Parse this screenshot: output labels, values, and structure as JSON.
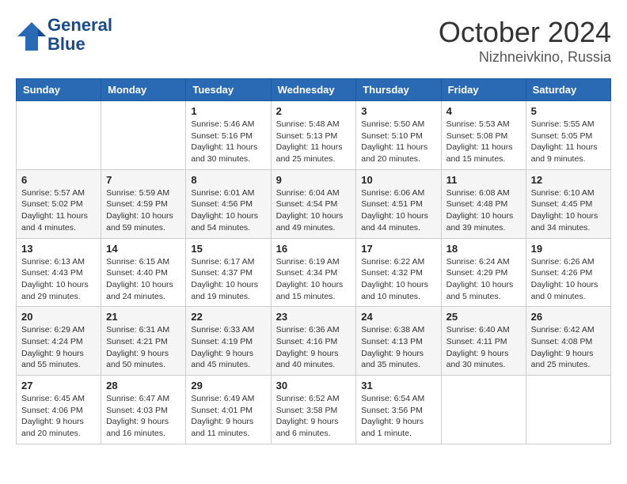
{
  "header": {
    "logo_line1": "General",
    "logo_line2": "Blue",
    "title": "October 2024",
    "subtitle": "Nizhneivkino, Russia"
  },
  "weekdays": [
    "Sunday",
    "Monday",
    "Tuesday",
    "Wednesday",
    "Thursday",
    "Friday",
    "Saturday"
  ],
  "weeks": [
    [
      {
        "day": "",
        "info": ""
      },
      {
        "day": "",
        "info": ""
      },
      {
        "day": "1",
        "info": "Sunrise: 5:46 AM\nSunset: 5:16 PM\nDaylight: 11 hours and 30 minutes."
      },
      {
        "day": "2",
        "info": "Sunrise: 5:48 AM\nSunset: 5:13 PM\nDaylight: 11 hours and 25 minutes."
      },
      {
        "day": "3",
        "info": "Sunrise: 5:50 AM\nSunset: 5:10 PM\nDaylight: 11 hours and 20 minutes."
      },
      {
        "day": "4",
        "info": "Sunrise: 5:53 AM\nSunset: 5:08 PM\nDaylight: 11 hours and 15 minutes."
      },
      {
        "day": "5",
        "info": "Sunrise: 5:55 AM\nSunset: 5:05 PM\nDaylight: 11 hours and 9 minutes."
      }
    ],
    [
      {
        "day": "6",
        "info": "Sunrise: 5:57 AM\nSunset: 5:02 PM\nDaylight: 11 hours and 4 minutes."
      },
      {
        "day": "7",
        "info": "Sunrise: 5:59 AM\nSunset: 4:59 PM\nDaylight: 10 hours and 59 minutes."
      },
      {
        "day": "8",
        "info": "Sunrise: 6:01 AM\nSunset: 4:56 PM\nDaylight: 10 hours and 54 minutes."
      },
      {
        "day": "9",
        "info": "Sunrise: 6:04 AM\nSunset: 4:54 PM\nDaylight: 10 hours and 49 minutes."
      },
      {
        "day": "10",
        "info": "Sunrise: 6:06 AM\nSunset: 4:51 PM\nDaylight: 10 hours and 44 minutes."
      },
      {
        "day": "11",
        "info": "Sunrise: 6:08 AM\nSunset: 4:48 PM\nDaylight: 10 hours and 39 minutes."
      },
      {
        "day": "12",
        "info": "Sunrise: 6:10 AM\nSunset: 4:45 PM\nDaylight: 10 hours and 34 minutes."
      }
    ],
    [
      {
        "day": "13",
        "info": "Sunrise: 6:13 AM\nSunset: 4:43 PM\nDaylight: 10 hours and 29 minutes."
      },
      {
        "day": "14",
        "info": "Sunrise: 6:15 AM\nSunset: 4:40 PM\nDaylight: 10 hours and 24 minutes."
      },
      {
        "day": "15",
        "info": "Sunrise: 6:17 AM\nSunset: 4:37 PM\nDaylight: 10 hours and 19 minutes."
      },
      {
        "day": "16",
        "info": "Sunrise: 6:19 AM\nSunset: 4:34 PM\nDaylight: 10 hours and 15 minutes."
      },
      {
        "day": "17",
        "info": "Sunrise: 6:22 AM\nSunset: 4:32 PM\nDaylight: 10 hours and 10 minutes."
      },
      {
        "day": "18",
        "info": "Sunrise: 6:24 AM\nSunset: 4:29 PM\nDaylight: 10 hours and 5 minutes."
      },
      {
        "day": "19",
        "info": "Sunrise: 6:26 AM\nSunset: 4:26 PM\nDaylight: 10 hours and 0 minutes."
      }
    ],
    [
      {
        "day": "20",
        "info": "Sunrise: 6:29 AM\nSunset: 4:24 PM\nDaylight: 9 hours and 55 minutes."
      },
      {
        "day": "21",
        "info": "Sunrise: 6:31 AM\nSunset: 4:21 PM\nDaylight: 9 hours and 50 minutes."
      },
      {
        "day": "22",
        "info": "Sunrise: 6:33 AM\nSunset: 4:19 PM\nDaylight: 9 hours and 45 minutes."
      },
      {
        "day": "23",
        "info": "Sunrise: 6:36 AM\nSunset: 4:16 PM\nDaylight: 9 hours and 40 minutes."
      },
      {
        "day": "24",
        "info": "Sunrise: 6:38 AM\nSunset: 4:13 PM\nDaylight: 9 hours and 35 minutes."
      },
      {
        "day": "25",
        "info": "Sunrise: 6:40 AM\nSunset: 4:11 PM\nDaylight: 9 hours and 30 minutes."
      },
      {
        "day": "26",
        "info": "Sunrise: 6:42 AM\nSunset: 4:08 PM\nDaylight: 9 hours and 25 minutes."
      }
    ],
    [
      {
        "day": "27",
        "info": "Sunrise: 6:45 AM\nSunset: 4:06 PM\nDaylight: 9 hours and 20 minutes."
      },
      {
        "day": "28",
        "info": "Sunrise: 6:47 AM\nSunset: 4:03 PM\nDaylight: 9 hours and 16 minutes."
      },
      {
        "day": "29",
        "info": "Sunrise: 6:49 AM\nSunset: 4:01 PM\nDaylight: 9 hours and 11 minutes."
      },
      {
        "day": "30",
        "info": "Sunrise: 6:52 AM\nSunset: 3:58 PM\nDaylight: 9 hours and 6 minutes."
      },
      {
        "day": "31",
        "info": "Sunrise: 6:54 AM\nSunset: 3:56 PM\nDaylight: 9 hours and 1 minute."
      },
      {
        "day": "",
        "info": ""
      },
      {
        "day": "",
        "info": ""
      }
    ]
  ]
}
